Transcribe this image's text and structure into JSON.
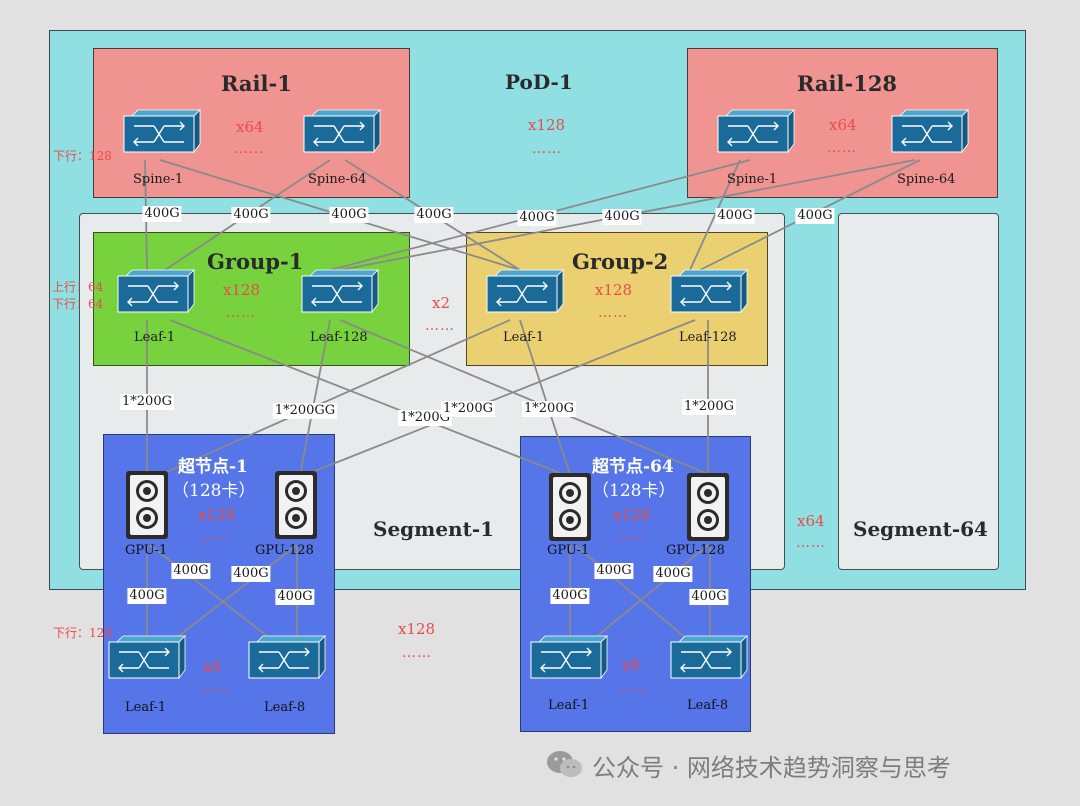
{
  "pod": {
    "title": "PoD-1",
    "mult": "x128",
    "dots": "……"
  },
  "rail_left": {
    "title": "Rail-1",
    "mult": "x64",
    "dots": "……",
    "spine_left": "Spine-1",
    "spine_right": "Spine-64",
    "note": "下行：128"
  },
  "rail_right": {
    "title": "Rail-128",
    "mult": "x64",
    "dots": "……",
    "spine_left": "Spine-1",
    "spine_right": "Spine-64"
  },
  "group1": {
    "title": "Group-1",
    "mult": "x128",
    "dots": "……",
    "leaf_left": "Leaf-1",
    "leaf_right": "Leaf-128",
    "note_up": "上行：64",
    "note_down": "下行：64"
  },
  "group2": {
    "title": "Group-2",
    "mult": "x128",
    "dots": "……",
    "leaf_left": "Leaf-1",
    "leaf_right": "Leaf-128"
  },
  "groups_mult": {
    "mult": "x2",
    "dots": "……"
  },
  "segment1": {
    "title": "Segment-1"
  },
  "segment64": {
    "title": "Segment-64"
  },
  "segments_mult": {
    "mult": "x64",
    "dots": "……"
  },
  "supernode1": {
    "title": "超节点-1",
    "subtitle": "（128卡）",
    "mult": "x128",
    "dots": "……",
    "gpu_left": "GPU-1",
    "gpu_right": "GPU-128",
    "leaf_mult": "x8",
    "leaf_dots": "……",
    "leaf_left": "Leaf-1",
    "leaf_right": "Leaf-8",
    "note": "下行：128"
  },
  "supernode64": {
    "title": "超节点-64",
    "subtitle": "（128卡）",
    "mult": "x128",
    "dots": "……",
    "gpu_left": "GPU-1",
    "gpu_right": "GPU-128",
    "leaf_mult": "x8",
    "leaf_dots": "……",
    "leaf_left": "Leaf-1",
    "leaf_right": "Leaf-8"
  },
  "supernodes_mult": {
    "mult": "x128",
    "dots": "……"
  },
  "link_labels": {
    "l400": "400G",
    "l200": "1*200G",
    "l200_overlap": "1*200GG",
    "l200_trim": "1*200G"
  },
  "watermark": {
    "text": "公众号 · 网络技术趋势洞察与思考"
  },
  "colors": {
    "pod": "#8fdfe3",
    "rail": "#f09492",
    "group1": "#77d23e",
    "group2": "#ead071",
    "segment": "#e8ebec",
    "supernode": "#5575e8",
    "device": "#1b6b9a",
    "highlight": "#ea4b4b"
  }
}
